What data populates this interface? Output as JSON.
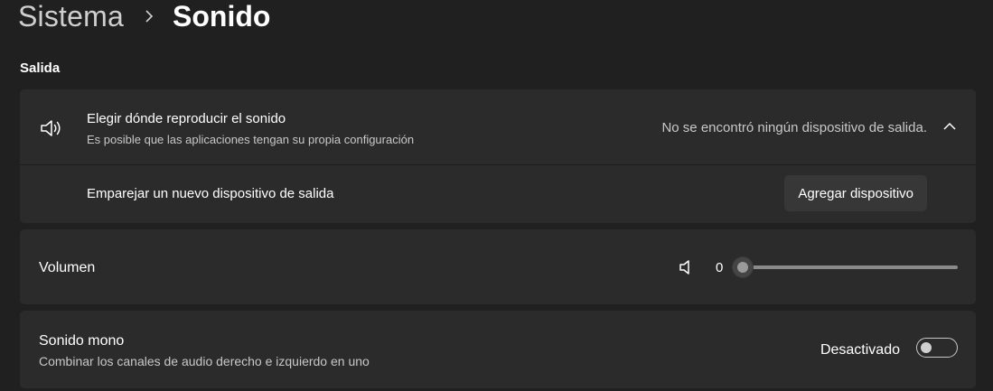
{
  "breadcrumb": {
    "parent": "Sistema",
    "current": "Sonido"
  },
  "output": {
    "section_title": "Salida",
    "choose": {
      "icon": "speaker-icon",
      "title": "Elegir dónde reproducir el sonido",
      "subtitle": "Es posible que las aplicaciones tengan su propia configuración",
      "status": "No se encontró ningún dispositivo de salida.",
      "expanded": true
    },
    "pair": {
      "title": "Emparejar un nuevo dispositivo de salida",
      "button_label": "Agregar dispositivo"
    }
  },
  "volume": {
    "label": "Volumen",
    "icon": "speaker-muted-icon",
    "value": "0",
    "slider_level": 0
  },
  "mono": {
    "title": "Sonido mono",
    "subtitle": "Combinar los canales de audio derecho e izquierdo en uno",
    "state_label": "Desactivado",
    "enabled": false
  },
  "colors": {
    "background": "#202020",
    "card": "#2b2b2b",
    "button": "#373737"
  }
}
